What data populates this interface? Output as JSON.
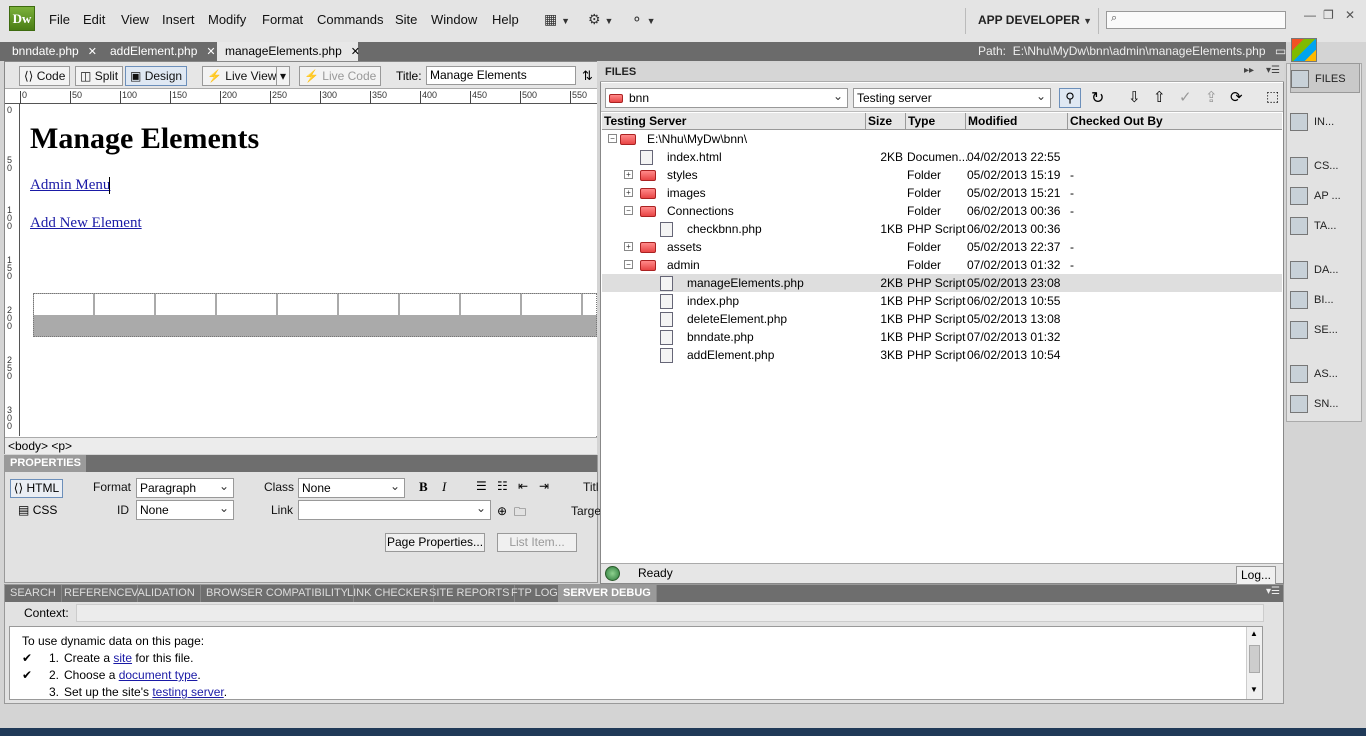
{
  "app": {
    "logo": "Dw"
  },
  "menu": [
    "File",
    "Edit",
    "View",
    "Insert",
    "Modify",
    "Format",
    "Commands",
    "Site",
    "Window",
    "Help"
  ],
  "workspace": "APP DEVELOPER",
  "doc_tabs": [
    {
      "label": "bnndate.php",
      "active": false
    },
    {
      "label": "addElement.php",
      "active": false
    },
    {
      "label": "manageElements.php",
      "active": true
    }
  ],
  "path_label": "Path:",
  "path_value": "E:\\Nhu\\MyDw\\bnn\\admin\\manageElements.php",
  "doc_toolbar": {
    "code": "Code",
    "split": "Split",
    "design": "Design",
    "live_view": "Live View",
    "live_code": "Live Code",
    "title_label": "Title:",
    "title_value": "Manage Elements"
  },
  "ruler_ticks": [
    "0",
    "50",
    "100",
    "150",
    "200",
    "250",
    "300",
    "350",
    "400",
    "450",
    "500",
    "550"
  ],
  "vruler_ticks": [
    "0",
    "5\n0",
    "1\n0\n0",
    "1\n5\n0",
    "2\n0\n0",
    "2\n5\n0",
    "3\n0\n0"
  ],
  "page": {
    "heading": "Manage Elements",
    "link1": "Admin Menu",
    "link2": "Add New Element"
  },
  "tag_selector": "<body> <p>",
  "properties": {
    "tab": "PROPERTIES",
    "html_btn": "HTML",
    "css_btn": "CSS",
    "format_label": "Format",
    "format_value": "Paragraph",
    "id_label": "ID",
    "id_value": "None",
    "class_label": "Class",
    "class_value": "None",
    "link_label": "Link",
    "link_value": "",
    "title_label": "Titl",
    "target_label": "Targe",
    "page_properties": "Page Properties...",
    "list_item": "List Item..."
  },
  "files_panel": {
    "tab": "FILES",
    "site": "bnn",
    "server": "Testing server",
    "columns": [
      "Testing Server",
      "Size",
      "Type",
      "Modified",
      "Checked Out By"
    ],
    "rows": [
      {
        "name": "E:\\Nhu\\MyDw\\bnn\\",
        "size": "",
        "type": "",
        "modified": "",
        "checked": "",
        "kind": "root",
        "indent": 0,
        "exp": "−"
      },
      {
        "name": "index.html",
        "size": "2KB",
        "type": "Documen...",
        "modified": "04/02/2013 22:55",
        "checked": "",
        "kind": "file",
        "indent": 1,
        "exp": ""
      },
      {
        "name": "styles",
        "size": "",
        "type": "Folder",
        "modified": "05/02/2013 15:19",
        "checked": "-",
        "kind": "folder",
        "indent": 1,
        "exp": "+"
      },
      {
        "name": "images",
        "size": "",
        "type": "Folder",
        "modified": "05/02/2013 15:21",
        "checked": "-",
        "kind": "folder",
        "indent": 1,
        "exp": "+"
      },
      {
        "name": "Connections",
        "size": "",
        "type": "Folder",
        "modified": "06/02/2013 00:36",
        "checked": "-",
        "kind": "folder",
        "indent": 1,
        "exp": "−"
      },
      {
        "name": "checkbnn.php",
        "size": "1KB",
        "type": "PHP Script",
        "modified": "06/02/2013 00:36",
        "checked": "",
        "kind": "file",
        "indent": 2,
        "exp": ""
      },
      {
        "name": "assets",
        "size": "",
        "type": "Folder",
        "modified": "05/02/2013 22:37",
        "checked": "-",
        "kind": "folder",
        "indent": 1,
        "exp": "+"
      },
      {
        "name": "admin",
        "size": "",
        "type": "Folder",
        "modified": "07/02/2013 01:32",
        "checked": "-",
        "kind": "folder",
        "indent": 1,
        "exp": "−"
      },
      {
        "name": "manageElements.php",
        "size": "2KB",
        "type": "PHP Script",
        "modified": "05/02/2013 23:08",
        "checked": "",
        "kind": "file",
        "indent": 2,
        "exp": "",
        "selected": true
      },
      {
        "name": "index.php",
        "size": "1KB",
        "type": "PHP Script",
        "modified": "06/02/2013 10:55",
        "checked": "",
        "kind": "file",
        "indent": 2,
        "exp": ""
      },
      {
        "name": "deleteElement.php",
        "size": "1KB",
        "type": "PHP Script",
        "modified": "05/02/2013 13:08",
        "checked": "",
        "kind": "file",
        "indent": 2,
        "exp": ""
      },
      {
        "name": "bnndate.php",
        "size": "1KB",
        "type": "PHP Script",
        "modified": "07/02/2013 01:32",
        "checked": "",
        "kind": "file",
        "indent": 2,
        "exp": ""
      },
      {
        "name": "addElement.php",
        "size": "3KB",
        "type": "PHP Script",
        "modified": "06/02/2013 10:54",
        "checked": "",
        "kind": "file",
        "indent": 2,
        "exp": ""
      }
    ],
    "status": "Ready",
    "log_btn": "Log..."
  },
  "right_panels": [
    {
      "label": "FILES",
      "icon": "files-icon",
      "active": true
    },
    {
      "label": "IN...",
      "icon": "insert-icon"
    },
    {
      "label": "CS...",
      "icon": "css-styles-icon"
    },
    {
      "label": "AP ...",
      "icon": "ap-elements-icon"
    },
    {
      "label": "TA...",
      "icon": "tag-inspector-icon"
    },
    {
      "label": "DA...",
      "icon": "databases-icon"
    },
    {
      "label": "BI...",
      "icon": "bindings-icon"
    },
    {
      "label": "SE...",
      "icon": "server-behaviors-icon"
    },
    {
      "label": "AS...",
      "icon": "assets-icon"
    },
    {
      "label": "SN...",
      "icon": "snippets-icon"
    }
  ],
  "bottom_tabs": [
    "SEARCH",
    "REFERENCE",
    "VALIDATION",
    "BROWSER COMPATIBILITY",
    "LINK CHECKER",
    "SITE REPORTS",
    "FTP LOG",
    "SERVER DEBUG"
  ],
  "server_debug": {
    "context_label": "Context:",
    "intro": "To use dynamic data on this page:",
    "steps": [
      {
        "check": "✔",
        "num": "1.",
        "pre": "Create a ",
        "link": "site",
        "post": " for this file."
      },
      {
        "check": "✔",
        "num": "2.",
        "pre": "Choose a ",
        "link": "document type",
        "post": "."
      },
      {
        "check": "",
        "num": "3.",
        "pre": "Set up the site's ",
        "link": "testing server",
        "post": "."
      }
    ]
  }
}
